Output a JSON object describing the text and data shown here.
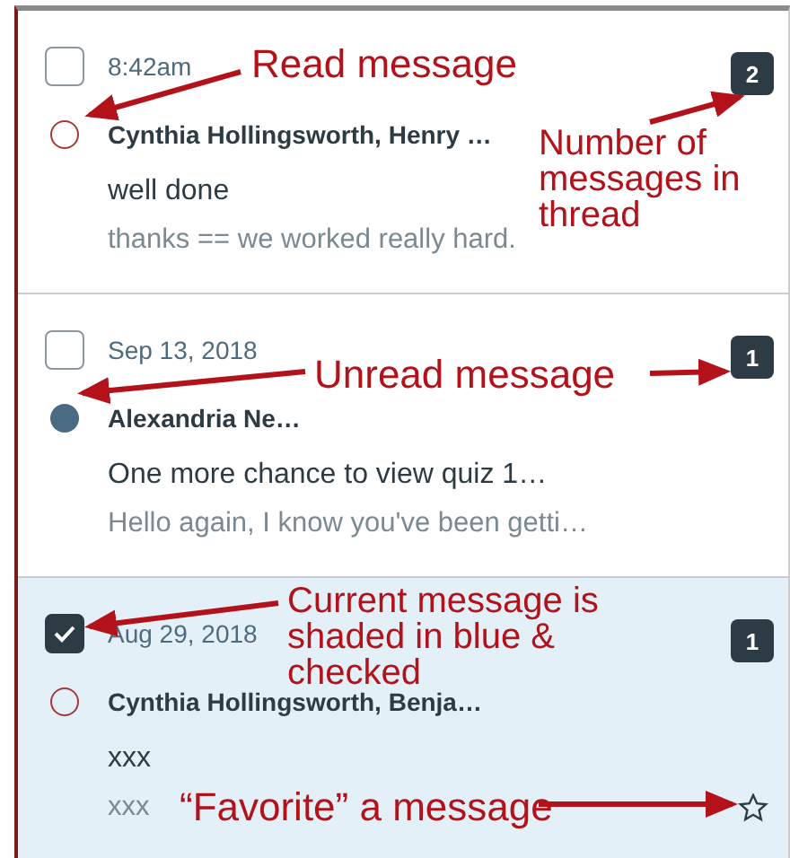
{
  "messages": [
    {
      "checked": false,
      "read": true,
      "selected": false,
      "date": "8:42am",
      "participants": "Cynthia Hollingsworth, Henry …",
      "subject": "well done",
      "preview": "thanks == we worked really hard.",
      "count": "2"
    },
    {
      "checked": false,
      "read": false,
      "selected": false,
      "date": "Sep 13, 2018",
      "participants": "Alexandria Ne…",
      "subject": "One more chance to view quiz 1…",
      "preview": "Hello again, I know you've been getti…",
      "count": "1"
    },
    {
      "checked": true,
      "read": true,
      "selected": true,
      "starred": false,
      "date": "Aug 29, 2018",
      "participants": "Cynthia Hollingsworth, Benja…",
      "subject": "xxx",
      "preview": "xxx",
      "count": "1"
    }
  ],
  "annotations": [
    {
      "text": "Read message"
    },
    {
      "text": "Number of messages in thread"
    },
    {
      "text": "Unread message"
    },
    {
      "text": "Current message is shaded in blue & checked"
    },
    {
      "text": "“Favorite” a message"
    }
  ]
}
